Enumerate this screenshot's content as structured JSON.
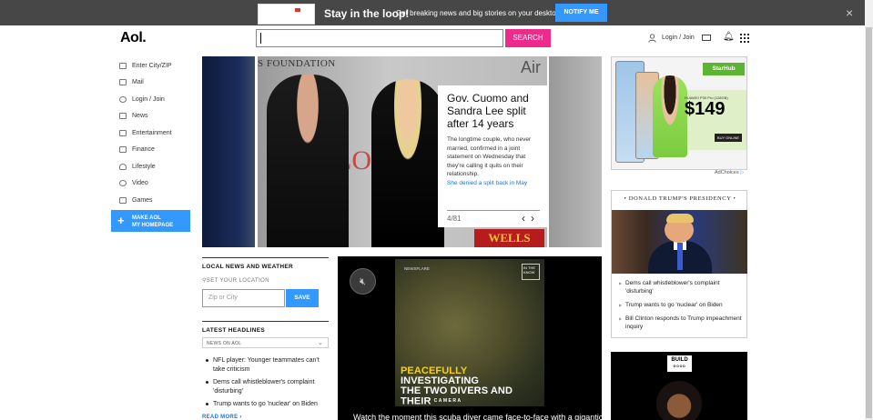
{
  "notify_bar": {
    "headline": "Stay in the loop!",
    "message": "Get breaking news and big stories on your desktop",
    "button": "NOTIFY ME",
    "close": "×"
  },
  "header": {
    "logo": "Aol.",
    "search_value": "",
    "search_button": "SEARCH",
    "login": "Login / Join"
  },
  "sidebar": {
    "items": [
      {
        "label": "Enter City/ZIP",
        "icon": "weather-icon"
      },
      {
        "label": "Mail",
        "icon": "mail-icon"
      },
      {
        "label": "Login / Join",
        "icon": "user-icon"
      },
      {
        "label": "News",
        "icon": "news-icon"
      },
      {
        "label": "Entertainment",
        "icon": "entertainment-icon"
      },
      {
        "label": "Finance",
        "icon": "finance-icon"
      },
      {
        "label": "Lifestyle",
        "icon": "heart-icon"
      },
      {
        "label": "Video",
        "icon": "play-icon"
      },
      {
        "label": "Games",
        "icon": "games-icon"
      }
    ],
    "make_homepage_line1": "MAKE AOL",
    "make_homepage_line2": "MY HOMEPAGE"
  },
  "hero": {
    "wall_text": "S FOUNDATION",
    "wall_air": "Air",
    "backdrop_text": "LON",
    "sign_text": "WELLS",
    "title": "Gov. Cuomo and Sandra Lee split after 14 years",
    "description": "The longtime couple, who never married, confirmed in a joint statement on Wednesday that they're calling it quits on their relationship.",
    "link": "She denied a split back in May",
    "counter": "4/81"
  },
  "local": {
    "heading": "LOCAL NEWS AND WEATHER",
    "set_location": "SET YOUR LOCATION",
    "zip_placeholder": "Zip or City",
    "save": "SAVE"
  },
  "latest": {
    "heading": "LATEST HEADLINES",
    "selected": "NEWS ON AOL",
    "items": [
      "NFL player: Younger teammates can't take criticism",
      "Dems call whistleblower's complaint 'disturbing'",
      "Trump wants to go 'nuclear' on Biden"
    ],
    "read_more": "READ MORE ›"
  },
  "video": {
    "brand": "NEWSFLARE",
    "badge": "IN THE KNOW",
    "caption_yellow": "PEACEFULLY",
    "caption_1": "INVESTIGATING",
    "caption_2": "THE TWO DIVERS AND",
    "caption_3": "THEIR",
    "caption_cam": "CAMERA",
    "title": "Watch the moment this scuba diver came face-to-face with a gigantic"
  },
  "ad": {
    "brand": "StarHub",
    "model": "HUAWEI P30 Pro (128GB)",
    "price": "$149",
    "buy": "BUY ONLINE",
    "adchoices": "AdChoices"
  },
  "trump_widget": {
    "heading": "• DONALD TRUMP'S PRESIDENCY •",
    "items": [
      "Dems call whistleblower's complaint 'disturbing'",
      "Trump wants to go 'nuclear' on Biden",
      "Bill Clinton responds to Trump impeachment inquiry"
    ]
  },
  "build": {
    "logo": "BUILD",
    "sub": "GOOD"
  },
  "colors": {
    "accent_blue": "#3399ff",
    "search_pink": "#ee2b8a"
  }
}
